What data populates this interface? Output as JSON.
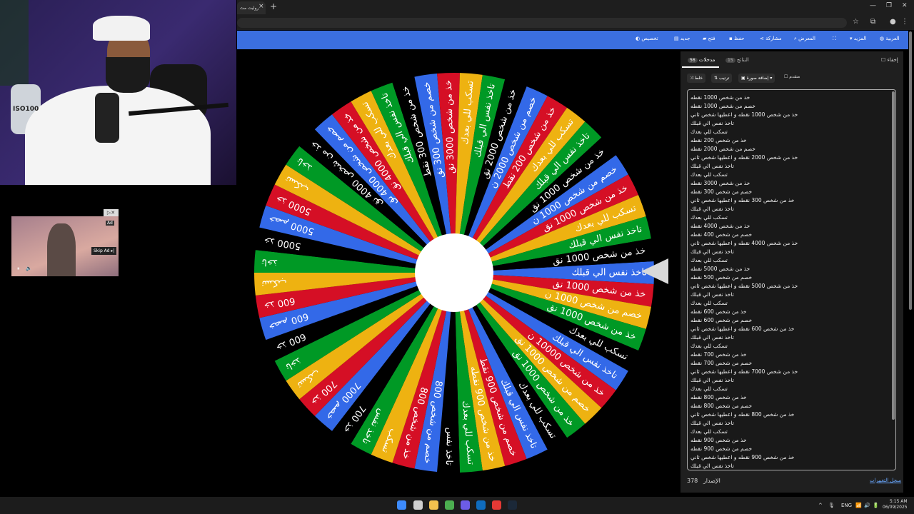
{
  "browser": {
    "tab_title": "روليت مث",
    "tab_close": "×",
    "new_tab": "+",
    "window_minimize": "—",
    "window_restore": "❐",
    "window_close": "✕"
  },
  "toolbar": {
    "items": [
      {
        "label": "تخصيص",
        "icon": "palette-icon"
      },
      {
        "label": "جديد",
        "icon": "new-file-icon"
      },
      {
        "label": "فتح",
        "icon": "folder-icon"
      },
      {
        "label": "حفظ",
        "icon": "save-icon"
      },
      {
        "label": "مشاركة",
        "icon": "share-icon"
      },
      {
        "label": "المعرض",
        "icon": "search-icon"
      },
      {
        "label": "",
        "icon": "fullscreen-icon"
      },
      {
        "label": "المزيد",
        "icon": "dropdown-icon"
      },
      {
        "label": "العربية",
        "icon": "globe-icon"
      }
    ]
  },
  "webcam": {
    "bottle_label": "ISO100"
  },
  "ad": {
    "tag": "Ad",
    "skip_label": "Skip Ad ▸|",
    "close": "▷✕",
    "pause": "⏸",
    "mute": "🔈"
  },
  "wheel": {
    "segment_count": 55,
    "colors": [
      "#3369e8",
      "#d50f25",
      "#eeb211",
      "#009925",
      "#000000"
    ],
    "center_color": "#ffffff",
    "labels": [
      "تاخذ نفس الي قبلك",
      "خذ من شخص 1000 نق",
      "خصم من شخص 1000 ن",
      "خذ من شخص 1000 نق",
      "تسكب للي بعدك",
      "تاخذ نفس الي قبلك",
      "خذ من شخص 10000 ن",
      "خصم من شخص 1000 نق",
      "خذ من شخص 1000 نق",
      "تسكب للي بعدك",
      "تاخذ نفس الي قبلك",
      "خصم من شخص 900 نقط",
      "خذ من شخص 900 نقطه",
      "تسكب للي بعدك",
      "تاخذ نفس",
      "خصم من شخص 800",
      "خذ من شخص 800",
      "تسكب",
      "تاخذ نفس",
      "خذ 700",
      "خصم 7000",
      "خذ 700",
      "تسكب",
      "تاخذ",
      "خذ 600",
      "خصم 600",
      "خذ 600",
      "تسكب",
      "تاخذ",
      "خذ 5000",
      "خصم 5000",
      "خذ 5000",
      "تسكب",
      "تاخذ",
      "خذ من شخص 4000 نق",
      "خصم من شخص 4000 نق",
      "خذ من شخص 4000 نق",
      "تسكب للي بعدك",
      "تاخذ نفس الي قبلك",
      "خذ من شخص 300 نقط",
      "خصم من شخص 300 نق",
      "خذ من شخص 3000 نق",
      "تسكب للي بعدك",
      "تاخذ نفس الي قبلك",
      "خذ من شخص 2000 نق",
      "خصم من شخص 2000 ن",
      "خذ من شخص 200 نقط",
      "تسكب للي بعدك",
      "تاخذ نفس الي قبلك",
      "خذ من شخص 1000 نق",
      "خصم من شخص 1000 ن",
      "خذ من شخص 1000 نق",
      "تسكب للي بعدك",
      "تاخذ نفس الي قبلك",
      "خذ من شخص 1000 نق"
    ]
  },
  "panel": {
    "tab_entries": "مدخلات",
    "tab_entries_count": "56",
    "tab_results": "النتائج",
    "tab_results_count": "15",
    "hide_label": "إخفاء",
    "buttons": [
      {
        "label": "خلط",
        "icon": "shuffle-icon"
      },
      {
        "label": "ترتيب",
        "icon": "sort-icon"
      },
      {
        "label": "إضافة صورة ▾",
        "icon": "image-icon"
      }
    ],
    "advanced_label": "متقدم",
    "entries": [
      "خذ من شخص 1000 نقطه",
      "خصم من شخص 1000 نقطه",
      "خذ من شخص 1000 نقطه و اعطيها شخص ثاني",
      "تاخذ نفس الي قبلك",
      "تسكب للي بعدك",
      "خذ من شخص 200 نقطه",
      "خصم من شخص 2000 نقطه",
      "خذ من شخص 2000 نقطه و اعطيها شخص ثاني",
      "تاخذ نفس الي قبلك",
      "تسكب للي بعدك",
      "خذ من شخص 3000 نقطه",
      "خصم من شخص 300 نقطه",
      "خذ من شخص 300 نقطه و اعطيها شخص ثاني",
      "تاخذ نفس الي قبلك",
      "تسكب للي بعدك",
      "خذ من شخص 4000 نقطه",
      "خصم من شخص 400 نقطه",
      "خذ من شخص 4000 نقطه و اعطيها شخص ثاني",
      "تاخذ نفس الي قبلك",
      "تسكب للي بعدك",
      "خذ من شخص 5000 نقطه",
      "خصم من شخص 500 نقطه",
      "خذ من شخص 5000 نقطه و اعطيها شخص ثاني",
      "تاخذ نفس الي قبلك",
      "تسكب للي بعدك",
      "خذ من شخص 600 نقطه",
      "خصم من شخص 600 نقطه",
      "خذ من شخص 600 نقطه و اعطيها شخص ثاني",
      "تاخذ نفس الي قبلك",
      "تسكب للي بعدك",
      "خذ من شخص 700 نقطه",
      "خصم من شخص 700 نقطه",
      "خذ من شخص 7000 نقطه و اعطيها شخص ثاني",
      "تاخذ نفس الي قبلك",
      "تسكب للي بعدك",
      "خذ من شخص 800 نقطه",
      "خصم من شخص 800 نقطه",
      "خذ من شخص 800 نقطه و اعطيها شخص ثاني",
      "تاخذ نفس الي قبلك",
      "تسكب للي بعدك",
      "خذ من شخص 900 نقطه",
      "خصم من شخص 900 نقطه",
      "خذ من شخص 900 نقطه و اعطيها شخص ثاني",
      "تاخذ نفس الي قبلك"
    ],
    "version_label": "الإصدار",
    "version_number": "378",
    "changelog_link": "سجل التغييرات"
  },
  "taskbar": {
    "icons": [
      "windows-start-icon",
      "search-icon",
      "file-explorer-icon",
      "chrome-icon",
      "app-icon",
      "outlook-icon",
      "red-app-icon",
      "steam-icon"
    ],
    "tray": {
      "caret": "^",
      "mic": "🎙",
      "lang": "ENG",
      "wifi": "📶",
      "volume": "🔊",
      "battery": "🔋"
    },
    "time": "5:15 AM",
    "date": "06/09/2025"
  }
}
